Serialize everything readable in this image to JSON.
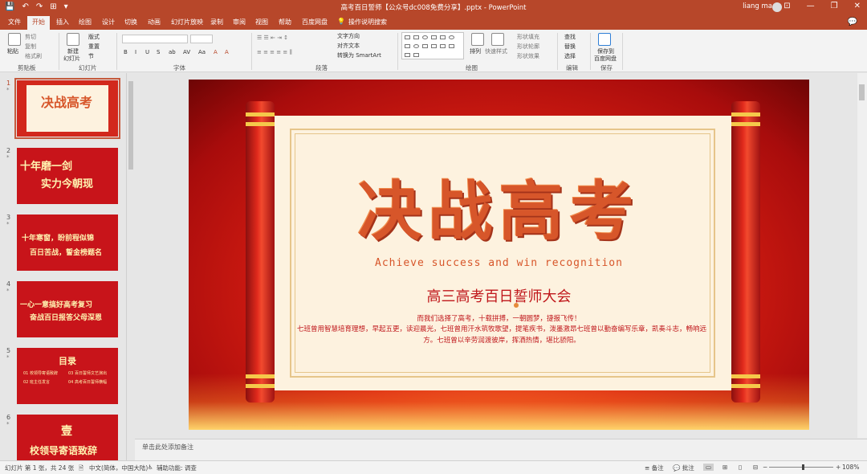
{
  "title_bar": {
    "qat": [
      "💾",
      "↶",
      "↷",
      "⊞",
      "▾"
    ],
    "document_title": "高考百日誓师【公众号dc008免费分享】.pptx - PowerPoint",
    "user": "liang ma",
    "window_buttons": [
      "⊡",
      "—",
      "❐",
      "✕"
    ]
  },
  "tabs": [
    "文件",
    "开始",
    "插入",
    "绘图",
    "设计",
    "切换",
    "动画",
    "幻灯片放映",
    "录制",
    "审阅",
    "视图",
    "帮助",
    "百度网盘",
    "操作说明搜索"
  ],
  "active_tab": "开始",
  "ribbon": {
    "clipboard": {
      "paste": "粘贴",
      "cut": "剪切",
      "copy": "复制",
      "format_painter": "格式刷",
      "label": "剪贴板"
    },
    "slides": {
      "new_slide": "新建",
      "new_slide2": "幻灯片",
      "layout": "版式",
      "reset": "重置",
      "section": "节",
      "label": "幻灯片"
    },
    "font": {
      "label": "字体",
      "styles": [
        "B",
        "I",
        "U",
        "S",
        "ab",
        "AV",
        "Aa",
        "A",
        "A"
      ]
    },
    "paragraph": {
      "label": "段落",
      "text_direction": "文字方向",
      "align_text": "对齐文本",
      "smartart": "转换为 SmartArt"
    },
    "drawing": {
      "label": "绘图",
      "arrange": "排列",
      "quick_styles": "快速样式",
      "shape_fill": "形状填充",
      "shape_outline": "形状轮廓",
      "shape_effects": "形状效果"
    },
    "editing": {
      "label": "编辑",
      "find": "查找",
      "replace": "替换",
      "select": "选择"
    },
    "save": {
      "label": "保存",
      "save_to": "保存到",
      "save_to2": "百度网盘"
    }
  },
  "thumbnails": [
    {
      "num": "1",
      "lines": [
        "决战高考"
      ],
      "selected": true
    },
    {
      "num": "2",
      "lines": [
        "十年磨一剑",
        "实力今朝现"
      ]
    },
    {
      "num": "3",
      "lines": [
        "十年寒窗，盼前程似锦",
        "百日苦战，誓金榜题名"
      ]
    },
    {
      "num": "4",
      "lines": [
        "一心一意搞好高考复习",
        "奋战百日报答父母深恩"
      ]
    },
    {
      "num": "5",
      "lines": [
        "目录",
        "01 校领导寄语致辞",
        "02 班主任发言",
        "03 百日誓师文艺演出",
        "04 高考百日誓师横幅"
      ]
    },
    {
      "num": "6",
      "lines": [
        "壹",
        "校领导寄语致辞"
      ]
    }
  ],
  "slide": {
    "title": "决战高考",
    "subtitle_en": "Achieve success and win recognition",
    "subtitle_cn": "高三高考百日誓师大会",
    "body1": "而我们选择了高考，十载拼搏，一朝圆梦，捷报飞传！",
    "body2": "七班曾用智慧培育理想，早起五更，读迎晨光，七班曾用汗水筑牧歌望，提笔疾书，泼墨激昂七班曾以勤奋编写乐章，凯奏斗志，畅响远方。七班曾以辛劳润渡彼岸，挥洒热情，堪比骄阳。"
  },
  "notes_placeholder": "单击此处添加备注",
  "status": {
    "slide_info": "幻灯片 第 1 张，共 24 张",
    "language": "中文(简体，中国大陆)",
    "accessibility": "辅助功能: 调查",
    "notes": "备注",
    "comments": "批注",
    "zoom": "108%"
  },
  "colors": {
    "accent": "#b7472a",
    "slide_red": "#c0171b",
    "gold": "#e6c58a"
  }
}
